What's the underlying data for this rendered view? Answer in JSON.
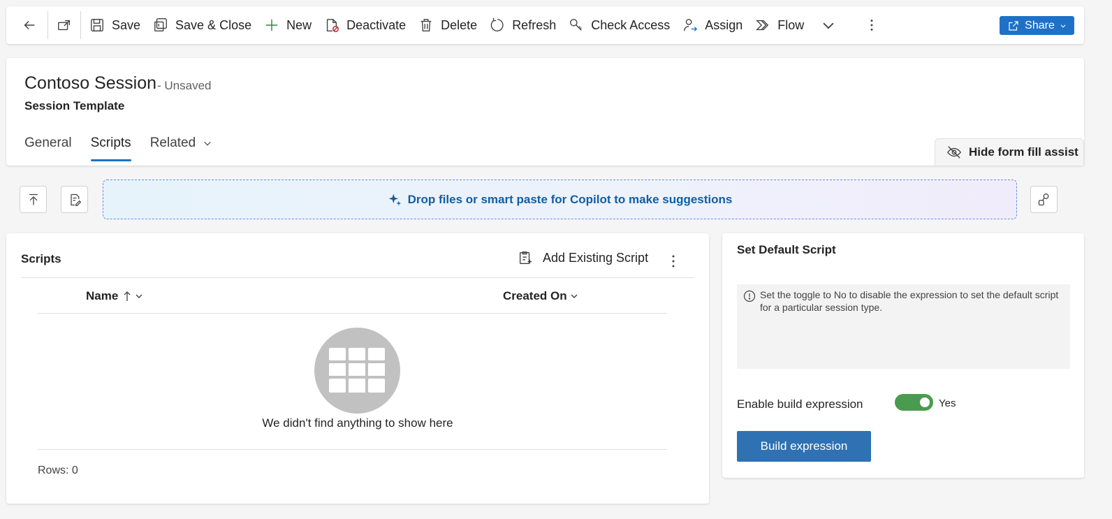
{
  "toolbar": {
    "save_label": "Save",
    "save_close_label": "Save & Close",
    "new_label": "New",
    "deactivate_label": "Deactivate",
    "delete_label": "Delete",
    "refresh_label": "Refresh",
    "check_access_label": "Check Access",
    "assign_label": "Assign",
    "flow_label": "Flow",
    "share_label": "Share"
  },
  "header": {
    "title": "Contoso Session",
    "status": "- Unsaved",
    "entity": "Session Template",
    "tabs": [
      {
        "label": "General"
      },
      {
        "label": "Scripts"
      },
      {
        "label": "Related"
      }
    ],
    "hide_assist_label": "Hide form fill assist"
  },
  "copilot": {
    "drop_label": "Drop files or smart paste for Copilot to make suggestions"
  },
  "scripts": {
    "title": "Scripts",
    "add_existing_label": "Add Existing Script",
    "columns": [
      {
        "label": "Name"
      },
      {
        "label": "Created On"
      }
    ],
    "empty_text": "We didn't find anything to show here",
    "rows_label": "Rows: 0"
  },
  "default_script": {
    "title": "Set Default Script",
    "info_text": "Set the toggle to No to disable the expression to set the default script for a particular session type.",
    "toggle_label": "Enable build expression",
    "toggle_value": "Yes",
    "build_button_label": "Build expression"
  },
  "colors": {
    "accent": "#1f71c7",
    "toggle_on": "#4a9b4f",
    "button": "#2f72b3"
  }
}
